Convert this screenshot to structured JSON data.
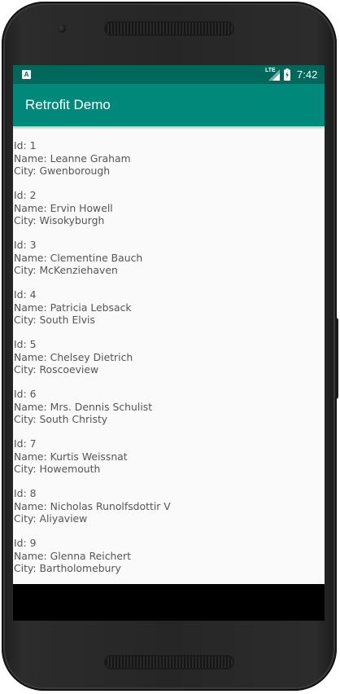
{
  "status_bar": {
    "notification_icon_letter": "A",
    "network_label": "LTE",
    "time": "7:42",
    "icons": [
      "signal-icon",
      "battery-icon"
    ]
  },
  "app_bar": {
    "title": "Retrofit Demo",
    "color": "#00897b",
    "status_color": "#00675b"
  },
  "users": [
    {
      "id_line": "Id: 1",
      "name_line": "Name: Leanne Graham",
      "city_line": "City: Gwenborough"
    },
    {
      "id_line": "Id: 2",
      "name_line": "Name: Ervin Howell",
      "city_line": "City: Wisokyburgh"
    },
    {
      "id_line": "Id: 3",
      "name_line": "Name: Clementine Bauch",
      "city_line": "City: McKenziehaven"
    },
    {
      "id_line": "Id: 4",
      "name_line": "Name: Patricia Lebsack",
      "city_line": "City: South Elvis"
    },
    {
      "id_line": "Id: 5",
      "name_line": "Name: Chelsey Dietrich",
      "city_line": "City: Roscoeview"
    },
    {
      "id_line": "Id: 6",
      "name_line": "Name: Mrs. Dennis Schulist",
      "city_line": "City: South Christy"
    },
    {
      "id_line": "Id: 7",
      "name_line": "Name: Kurtis Weissnat",
      "city_line": "City: Howemouth"
    },
    {
      "id_line": "Id: 8",
      "name_line": "Name: Nicholas Runolfsdottir V",
      "city_line": "City: Aliyaview"
    },
    {
      "id_line": "Id: 9",
      "name_line": "Name: Glenna Reichert",
      "city_line": "City: Bartholomebury"
    }
  ]
}
